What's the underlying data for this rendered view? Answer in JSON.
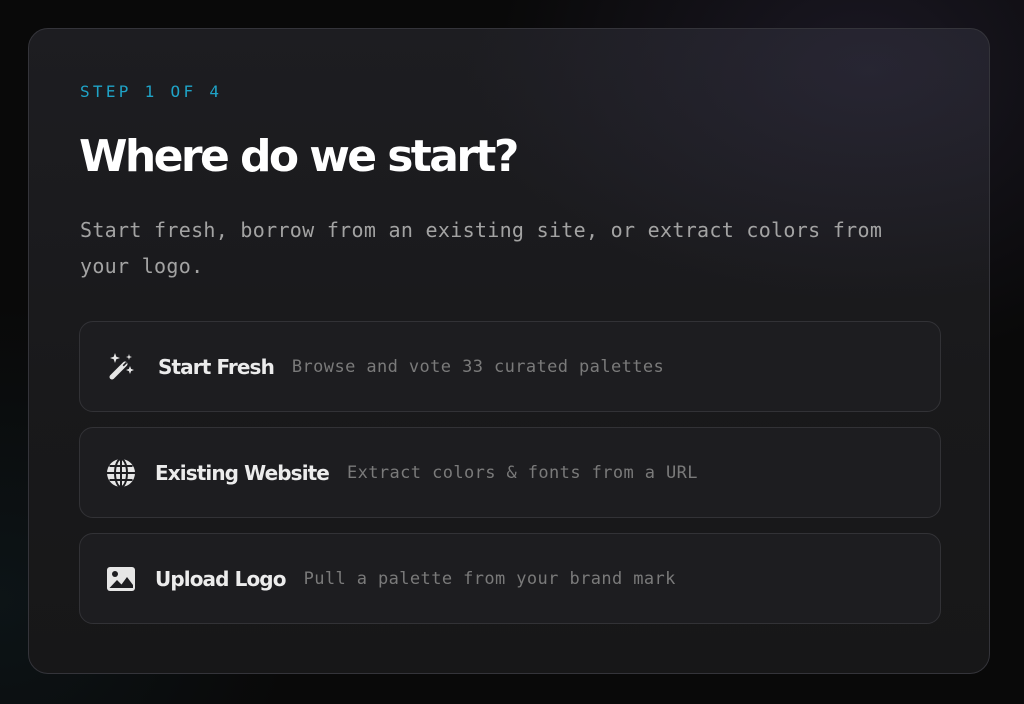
{
  "wizard": {
    "step_label": "STEP 1 OF 4",
    "title": "Where do we start?",
    "subtitle": "Start fresh, borrow from an existing site, or extract colors from your logo."
  },
  "options": [
    {
      "icon": "magic-wand-icon",
      "label": "Start Fresh",
      "description": "Browse and vote 33 curated palettes"
    },
    {
      "icon": "globe-icon",
      "label": "Existing Website",
      "description": "Extract colors & fonts from a URL"
    },
    {
      "icon": "image-icon",
      "label": "Upload Logo",
      "description": "Pull a palette from your brand mark"
    }
  ],
  "colors": {
    "accent": "#1fa3c7",
    "card_background": "#1a1a1c",
    "option_background": "#1d1d20",
    "title": "#ffffff",
    "muted_text": "#7a7a7a"
  }
}
